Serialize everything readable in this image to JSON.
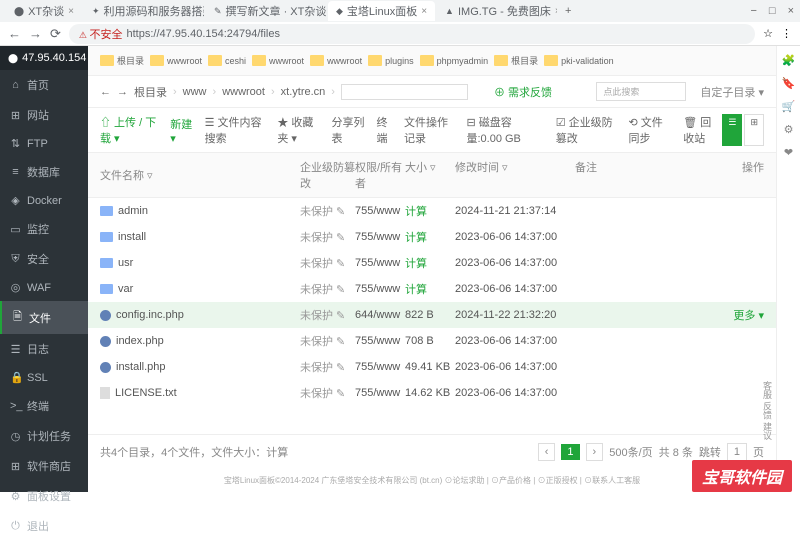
{
  "browser": {
    "tabs": [
      {
        "title": "XT杂谈"
      },
      {
        "title": "利用源码和服务器搭建一个网站..."
      },
      {
        "title": "撰写新文章 · XT杂谈 - Powered..."
      },
      {
        "title": "宝塔Linux面板",
        "active": true
      },
      {
        "title": "IMG.TG - 免费图床"
      }
    ],
    "win": {
      "min": "−",
      "max": "□",
      "close": "×"
    },
    "nav": {
      "back": "←",
      "fwd": "→",
      "reload": "⟳"
    },
    "security": "不安全",
    "url": "https://47.95.40.154:24794/files",
    "addr_icons": [
      "☆",
      "⋮"
    ]
  },
  "sidebar": {
    "ip": "47.95.40.154",
    "badge": "0",
    "items": [
      {
        "icon": "⌂",
        "label": "首页"
      },
      {
        "icon": "⊞",
        "label": "网站"
      },
      {
        "icon": "⇅",
        "label": "FTP"
      },
      {
        "icon": "≡",
        "label": "数据库"
      },
      {
        "icon": "◈",
        "label": "Docker"
      },
      {
        "icon": "▭",
        "label": "监控"
      },
      {
        "icon": "⛨",
        "label": "安全"
      },
      {
        "icon": "◎",
        "label": "WAF"
      },
      {
        "icon": "🗎",
        "label": "文件",
        "active": true
      },
      {
        "icon": "☰",
        "label": "日志"
      },
      {
        "icon": "🔒",
        "label": "SSL"
      },
      {
        "icon": ">_",
        "label": "终端"
      },
      {
        "icon": "◷",
        "label": "计划任务"
      },
      {
        "icon": "⊞",
        "label": "软件商店"
      },
      {
        "icon": "⚙",
        "label": "面板设置"
      },
      {
        "icon": "⏻",
        "label": "退出"
      }
    ]
  },
  "folders": [
    "根目录",
    "wwwroot",
    "ceshi",
    "wwwroot",
    "wwwroot",
    "plugins",
    "phpmyadmin",
    "根目录",
    "pki-validation"
  ],
  "breadcrumb": {
    "back": "←",
    "fwd": "→",
    "root": "根目录",
    "parts": [
      "www",
      "wwwroot",
      "xt.ytre.cn"
    ],
    "feedback": "⊕ 需求反馈",
    "search_ph": "点此搜索",
    "nav_up": "自定子目录 ▾"
  },
  "toolbar": {
    "upload": "⇧ 上传 / 下载 ▾",
    "new": "新建 ▾",
    "search": "☰ 文件内容搜索",
    "fav": "★ 收藏夹 ▾",
    "share": "分享列表",
    "term": "终端",
    "ops": "文件操作记录",
    "disk": "⊟ 磁盘容量:0.00 GB",
    "perm": "☑ 企业级防篡改",
    "sync": "⟲ 文件同步",
    "recycle": "🗑 回收站",
    "view_list": "☰",
    "view_grid": "⊞"
  },
  "columns": {
    "name": "文件名称 ▿",
    "sec": "企业级防篡改",
    "perm": "权限/所有者",
    "size": "大小 ▿",
    "time": "修改时间 ▿",
    "remark": "备注",
    "op": "操作"
  },
  "rows": [
    {
      "type": "folder",
      "name": "admin",
      "sec": "未保护",
      "perm": "755/www",
      "size": "计算",
      "time": "2024-11-21 21:37:14",
      "hl": false
    },
    {
      "type": "folder",
      "name": "install",
      "sec": "未保护",
      "perm": "755/www",
      "size": "计算",
      "time": "2023-06-06 14:37:00",
      "hl": false
    },
    {
      "type": "folder",
      "name": "usr",
      "sec": "未保护",
      "perm": "755/www",
      "size": "计算",
      "time": "2023-06-06 14:37:00",
      "hl": false
    },
    {
      "type": "folder",
      "name": "var",
      "sec": "未保护",
      "perm": "755/www",
      "size": "计算",
      "time": "2023-06-06 14:37:00",
      "hl": false
    },
    {
      "type": "php",
      "name": "config.inc.php",
      "sec": "未保护",
      "perm": "644/www",
      "size": "822 B",
      "time": "2024-11-22 21:32:20",
      "hl": true,
      "more": "更多 ▾"
    },
    {
      "type": "php",
      "name": "index.php",
      "sec": "未保护",
      "perm": "755/www",
      "size": "708 B",
      "time": "2023-06-06 14:37:00",
      "hl": false
    },
    {
      "type": "php",
      "name": "install.php",
      "sec": "未保护",
      "perm": "755/www",
      "size": "49.41 KB",
      "time": "2023-06-06 14:37:00",
      "hl": false
    },
    {
      "type": "txt",
      "name": "LICENSE.txt",
      "sec": "未保护",
      "perm": "755/www",
      "size": "14.62 KB",
      "time": "2023-06-06 14:37:00",
      "hl": false
    }
  ],
  "footer": {
    "summary": "共4个目录，4个文件，文件大小：计算",
    "prev": "‹",
    "page": "1",
    "next": "›",
    "perpage": "500条/页",
    "total": "共 8 条",
    "jump": "跳转",
    "pg": "1",
    "go": "页"
  },
  "copyright": "宝塔Linux面板©2014-2024 广东堡塔安全技术有限公司 (bt.cn)   ⊙论坛求助  |  ⊙产品价格  |  ⊙正版授权  |  ⊙联系人工客服",
  "feedback_side": "客服 反馈 建议",
  "watermark": "宝哥软件园"
}
